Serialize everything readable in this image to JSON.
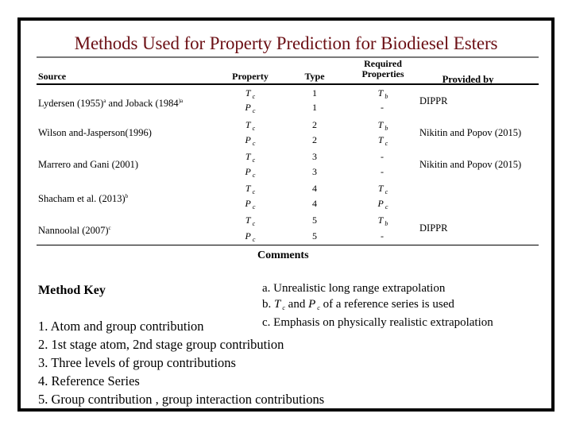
{
  "title": "Methods Used for Property Prediction for Biodiesel Esters",
  "colors": {
    "title": "#6b0f14",
    "frame": "#000000"
  },
  "table": {
    "headers": {
      "source": "Source",
      "property": "Property",
      "type": "Type",
      "required_line1": "Required",
      "required_line2": "Properties",
      "provided_by": "Provided by"
    },
    "sources": [
      {
        "name": "Lydersen (1955)",
        "sup1": "a",
        "name2": " and Joback (1984",
        "sup2": ")a",
        "provided_by": "DIPPR"
      },
      {
        "name": "Wilson and-Jasperson(1996)",
        "provided_by": "Nikitin and Popov (2015)"
      },
      {
        "name": "Marrero and Gani (2001)",
        "provided_by": "Nikitin and Popov (2015)"
      },
      {
        "name": "Shacham et al. (2013)",
        "sup1": "b",
        "provided_by": ""
      },
      {
        "name": "Nannoolal (2007)",
        "sup1": "c",
        "provided_by": "DIPPR"
      }
    ],
    "rows": [
      {
        "property": "T",
        "property_sub": "c",
        "type": "1",
        "required": "T",
        "required_sub": "b"
      },
      {
        "property": "P",
        "property_sub": "c",
        "type": "1",
        "required": "-",
        "required_sub": ""
      },
      {
        "property": "T",
        "property_sub": "c",
        "type": "2",
        "required": "T",
        "required_sub": "b"
      },
      {
        "property": "P",
        "property_sub": "c",
        "type": "2",
        "required": "T",
        "required_sub": "c"
      },
      {
        "property": "T",
        "property_sub": "c",
        "type": "3",
        "required": "-",
        "required_sub": ""
      },
      {
        "property": "P",
        "property_sub": "c",
        "type": "3",
        "required": "-",
        "required_sub": ""
      },
      {
        "property": "T",
        "property_sub": "c",
        "type": "4",
        "required": "T",
        "required_sub": "c"
      },
      {
        "property": "P",
        "property_sub": "c",
        "type": "4",
        "required": "P",
        "required_sub": "c"
      },
      {
        "property": "T",
        "property_sub": "c",
        "type": "5",
        "required": "T",
        "required_sub": "b"
      },
      {
        "property": "P",
        "property_sub": "c",
        "type": "5",
        "required": "-",
        "required_sub": ""
      }
    ]
  },
  "comments": {
    "heading": "Comments",
    "a": "a. Unrealistic long range extrapolation",
    "b_prefix": "b. ",
    "b_t": "T",
    "b_t_sub": "c",
    "b_and": " and ",
    "b_p": "P",
    "b_p_sub": "c",
    "b_suffix": " of a reference series is used",
    "c": "c. Emphasis on physically realistic extrapolation"
  },
  "method_key": {
    "heading": "Method Key",
    "items": [
      "1. Atom and group contribution",
      "2. 1st stage atom, 2nd stage group contribution",
      "3. Three levels of group contributions",
      "4. Reference Series",
      "5. Group contribution , group interaction contributions"
    ]
  }
}
